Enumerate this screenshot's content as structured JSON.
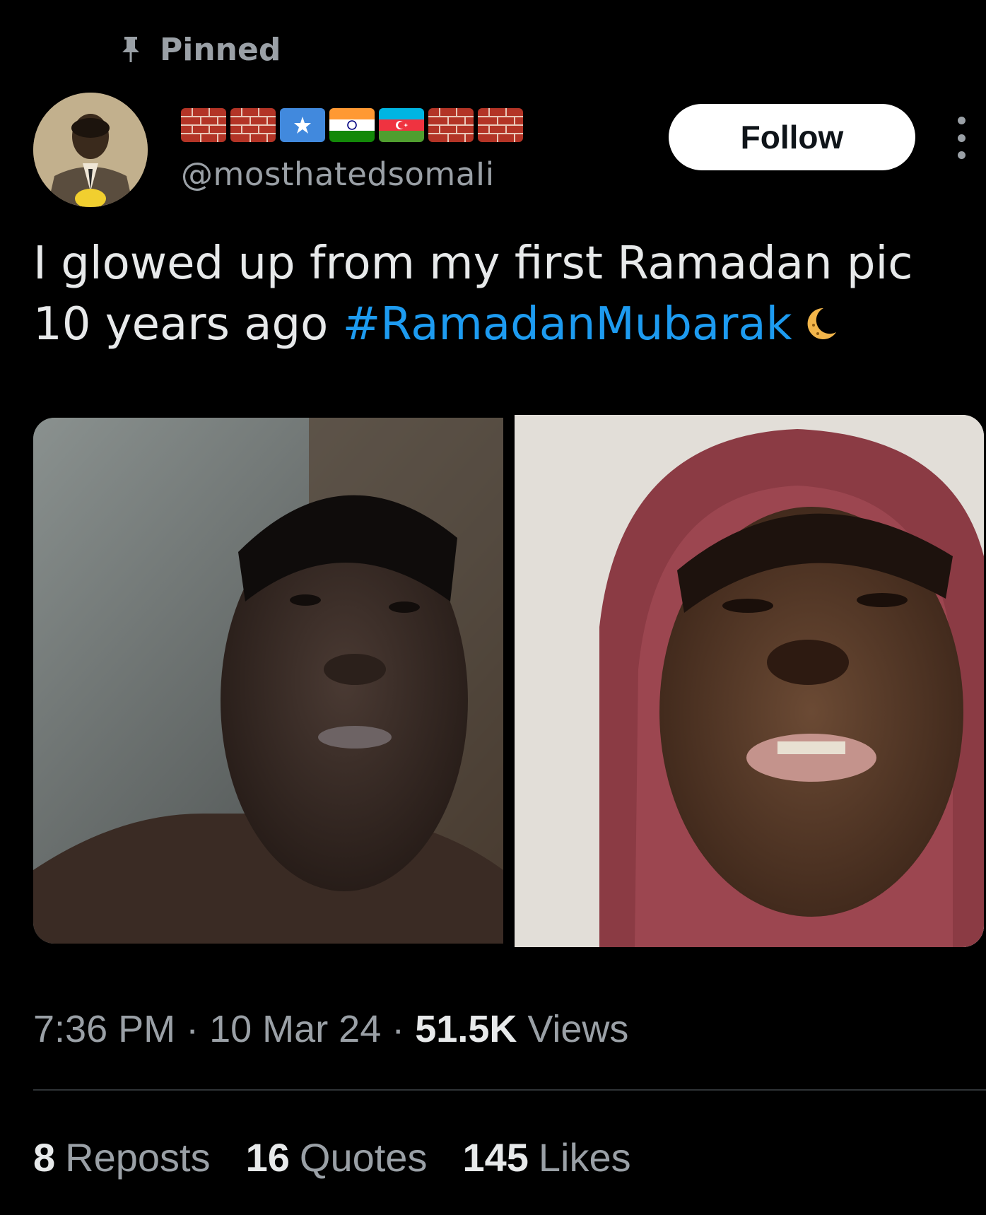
{
  "pinned": {
    "label": "Pinned",
    "icon": "pin-icon"
  },
  "author": {
    "avatar_icon": "avatar-photo",
    "display_name_emojis": [
      "brick-emoji",
      "brick-emoji",
      "flag-somalia",
      "flag-india",
      "flag-azerbaijan",
      "brick-emoji",
      "brick-emoji"
    ],
    "handle": "@mosthatedsomaIi"
  },
  "actions": {
    "follow_label": "Follow",
    "more_icon": "more-vertical-icon"
  },
  "tweet": {
    "text_line1": "I glowed up from my first Ramadan pic",
    "text_line2_prefix": "10 years ago ",
    "hashtag": "#RamadanMubarak",
    "emoji_icon": "crescent-moon-icon"
  },
  "meta": {
    "time": "7:36 PM",
    "sep1": " · ",
    "date": "10 Mar 24",
    "sep2": " · ",
    "views_count": "51.5K",
    "views_label": " Views"
  },
  "stats": {
    "reposts_count": "8",
    "reposts_label": "Reposts",
    "quotes_count": "16",
    "quotes_label": "Quotes",
    "likes_count": "145",
    "likes_label": "Likes"
  },
  "colors": {
    "background": "#000000",
    "text_primary": "#e7e9ea",
    "text_secondary": "#9aa0a6",
    "link": "#1d9bf0",
    "follow_bg": "#ffffff",
    "divider": "#2f3336"
  }
}
